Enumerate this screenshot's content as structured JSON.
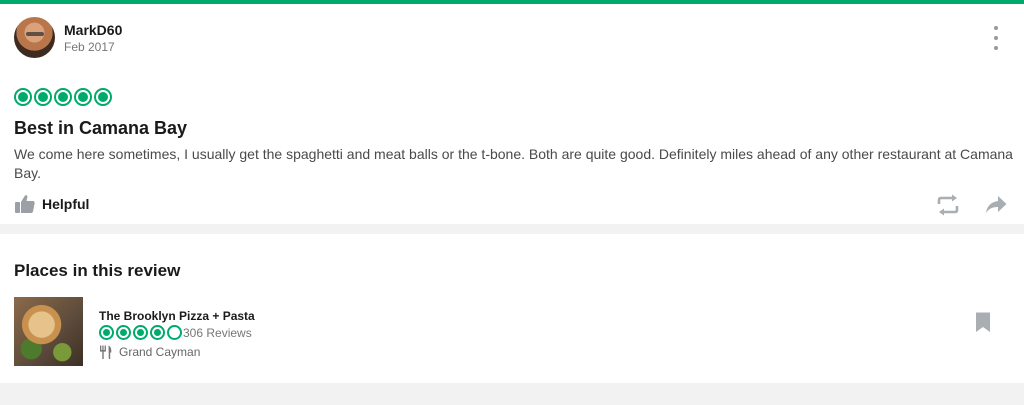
{
  "theme": {
    "accent": "#00aa6c",
    "icon_gray": "#999999"
  },
  "review": {
    "author": "MarkD60",
    "date": "Feb 2017",
    "rating": 5,
    "title": "Best in Camana Bay",
    "body": "We come here sometimes, I usually get the spaghetti and meat balls or the t-bone. Both are quite good. Definitely miles ahead of any other restaurant at Camana Bay.",
    "helpful_label": "Helpful",
    "icons": [
      "more-vertical-icon",
      "thumbs-up-icon",
      "repost-icon",
      "share-arrow-icon"
    ]
  },
  "places": {
    "heading": "Places in this review",
    "items": [
      {
        "name": "The Brooklyn Pizza + Pasta",
        "rating": 4,
        "reviews": "306 Reviews",
        "location": "Grand Cayman",
        "icons": [
          "restaurant-utensils-icon",
          "bookmark-icon"
        ]
      }
    ]
  }
}
